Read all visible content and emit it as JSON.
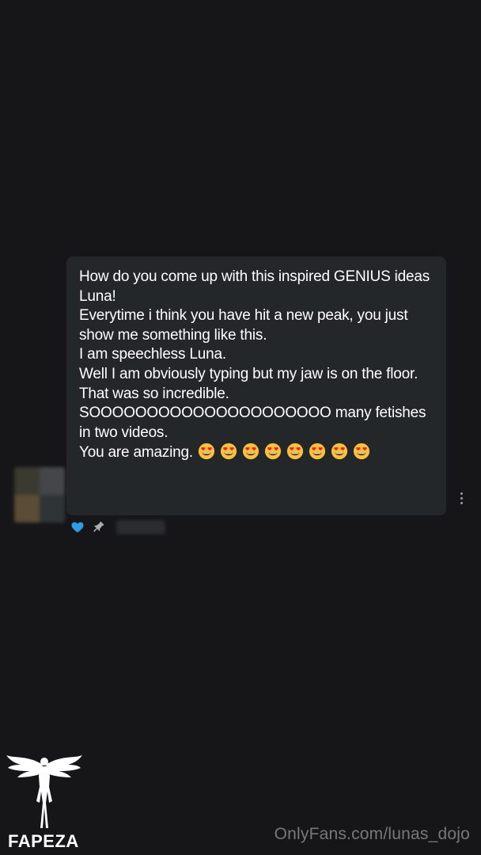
{
  "message": {
    "text": "How do you come up with this inspired GENIUS ideas Luna!\nEverytime i think you have hit a new peak, you just show me something like this.\nI am speechless Luna.\nWell I am obviously typing but my jaw is on the floor.\nThat was so incredible.\nSOOOOOOOOOOOOOOOOOOOOO many fetishes in two videos.\nYou are amazing.",
    "emoji_icon": "heart-eyes-emoji",
    "emoji_count": 8
  },
  "meta": {
    "like_icon": "heart-icon",
    "pin_icon": "pin-icon"
  },
  "menu": {
    "icon": "more-vertical-icon"
  },
  "watermark": {
    "text": "OnlyFans.com/lunas_dojo"
  },
  "logo": {
    "text": "FAPEZA",
    "icon": "angel-logo-icon"
  },
  "colors": {
    "background": "#161618",
    "bubble": "#24272a",
    "like": "#2e9be6"
  }
}
